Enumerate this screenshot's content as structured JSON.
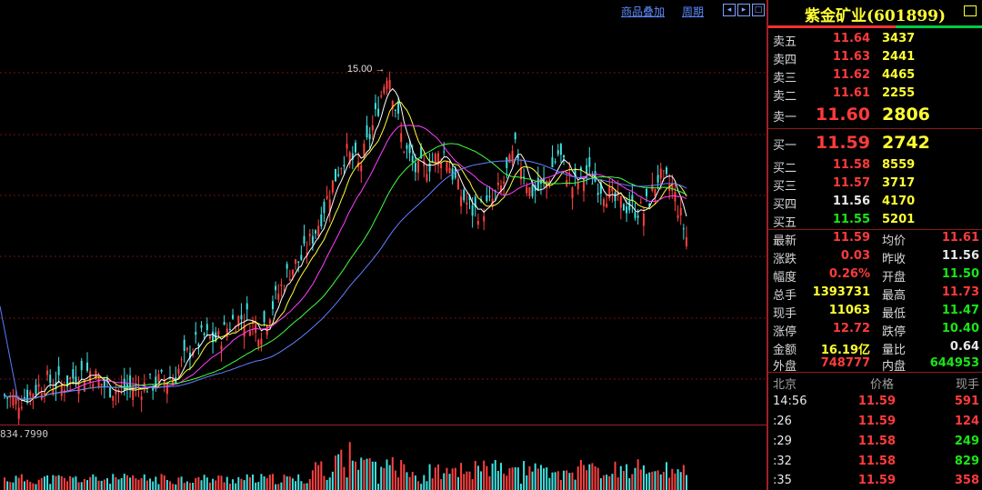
{
  "toolbar": {
    "overlay_label": "商品叠加",
    "period_label": "周期"
  },
  "chart": {
    "peak_label": "15.00",
    "volume_label": "834.7990"
  },
  "chart_data": {
    "type": "line",
    "kind": "candlestick-with-moving-averages",
    "annotations": [
      "15.00"
    ],
    "peak_value": 15.0,
    "y_range_estimate": [
      8.0,
      15.6
    ],
    "grid": true,
    "series": [
      {
        "name": "",
        "color": "#ffffff",
        "values": [
          8.4,
          8.3,
          8.5,
          8.7,
          8.6,
          8.8,
          8.9,
          8.6,
          8.5,
          8.55,
          8.6,
          8.7,
          8.8,
          9.3,
          9.6,
          9.5,
          9.9,
          10.0,
          9.7,
          10.3,
          10.9,
          11.2,
          11.8,
          12.6,
          13.3,
          13.0,
          13.9,
          15.0,
          13.5,
          12.9,
          13.1,
          13.3,
          12.5,
          12.1,
          12.2,
          12.6,
          13.4,
          12.5,
          12.6,
          13.3,
          12.6,
          12.9,
          12.6,
          12.3,
          12.2,
          12.1,
          12.8,
          12.6,
          11.59
        ]
      }
    ]
  },
  "quote": {
    "title": "紫金矿业(601899)",
    "sell": [
      {
        "label": "卖五",
        "price": "11.64",
        "qty": "3437"
      },
      {
        "label": "卖四",
        "price": "11.63",
        "qty": "2441"
      },
      {
        "label": "卖三",
        "price": "11.62",
        "qty": "4465"
      },
      {
        "label": "卖二",
        "price": "11.61",
        "qty": "2255"
      },
      {
        "label": "卖一",
        "price": "11.60",
        "qty": "2806"
      }
    ],
    "buy": [
      {
        "label": "买一",
        "price": "11.59",
        "qty": "2742"
      },
      {
        "label": "买二",
        "price": "11.58",
        "qty": "8559"
      },
      {
        "label": "买三",
        "price": "11.57",
        "qty": "3717"
      },
      {
        "label": "买四",
        "price": "11.56",
        "qty": "4170"
      },
      {
        "label": "买五",
        "price": "11.55",
        "qty": "5201"
      }
    ],
    "stats": [
      {
        "l1": "最新",
        "v1": "11.59",
        "l2": "均价",
        "v2": "11.61"
      },
      {
        "l1": "涨跌",
        "v1": "0.03",
        "l2": "昨收",
        "v2": "11.56"
      },
      {
        "l1": "幅度",
        "v1": "0.26%",
        "l2": "开盘",
        "v2": "11.50"
      },
      {
        "l1": "总手",
        "v1": "1393731",
        "l2": "最高",
        "v2": "11.73"
      },
      {
        "l1": "现手",
        "v1": "11063",
        "l2": "最低",
        "v2": "11.47"
      },
      {
        "l1": "涨停",
        "v1": "12.72",
        "l2": "跌停",
        "v2": "10.40"
      },
      {
        "l1": "金额",
        "v1": "16.19亿",
        "l2": "量比",
        "v2": "0.64"
      },
      {
        "l1": "外盘",
        "v1": "748777",
        "l2": "内盘",
        "v2": "644953"
      }
    ],
    "ticks_header": {
      "col1": "北京",
      "col2": "价格",
      "col3": "现手"
    },
    "ticks": [
      {
        "time": "14:56",
        "price": "11.59",
        "vol": "591"
      },
      {
        "time": ":26",
        "price": "11.59",
        "vol": "124"
      },
      {
        "time": ":29",
        "price": "11.58",
        "vol": "249"
      },
      {
        "time": ":32",
        "price": "11.58",
        "vol": "829"
      },
      {
        "time": ":35",
        "price": "11.59",
        "vol": "358"
      }
    ]
  }
}
